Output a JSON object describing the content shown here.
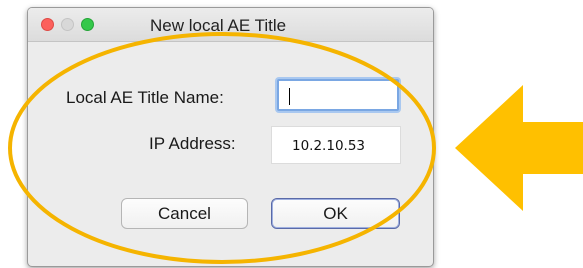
{
  "window": {
    "title": "New local AE Title",
    "controls": {
      "close": "close-icon",
      "minimize": "minimize-icon",
      "zoom": "zoom-icon"
    }
  },
  "form": {
    "ae_title_label": "Local AE Title Name:",
    "ae_title_value": "",
    "ip_label": "IP Address:",
    "ip_value": "10.2.10.53"
  },
  "buttons": {
    "cancel_label": "Cancel",
    "ok_label": "OK"
  },
  "annotation": {
    "highlight_color": "#f5b400",
    "arrow_color": "#ffc000",
    "arrow_direction": "left"
  }
}
